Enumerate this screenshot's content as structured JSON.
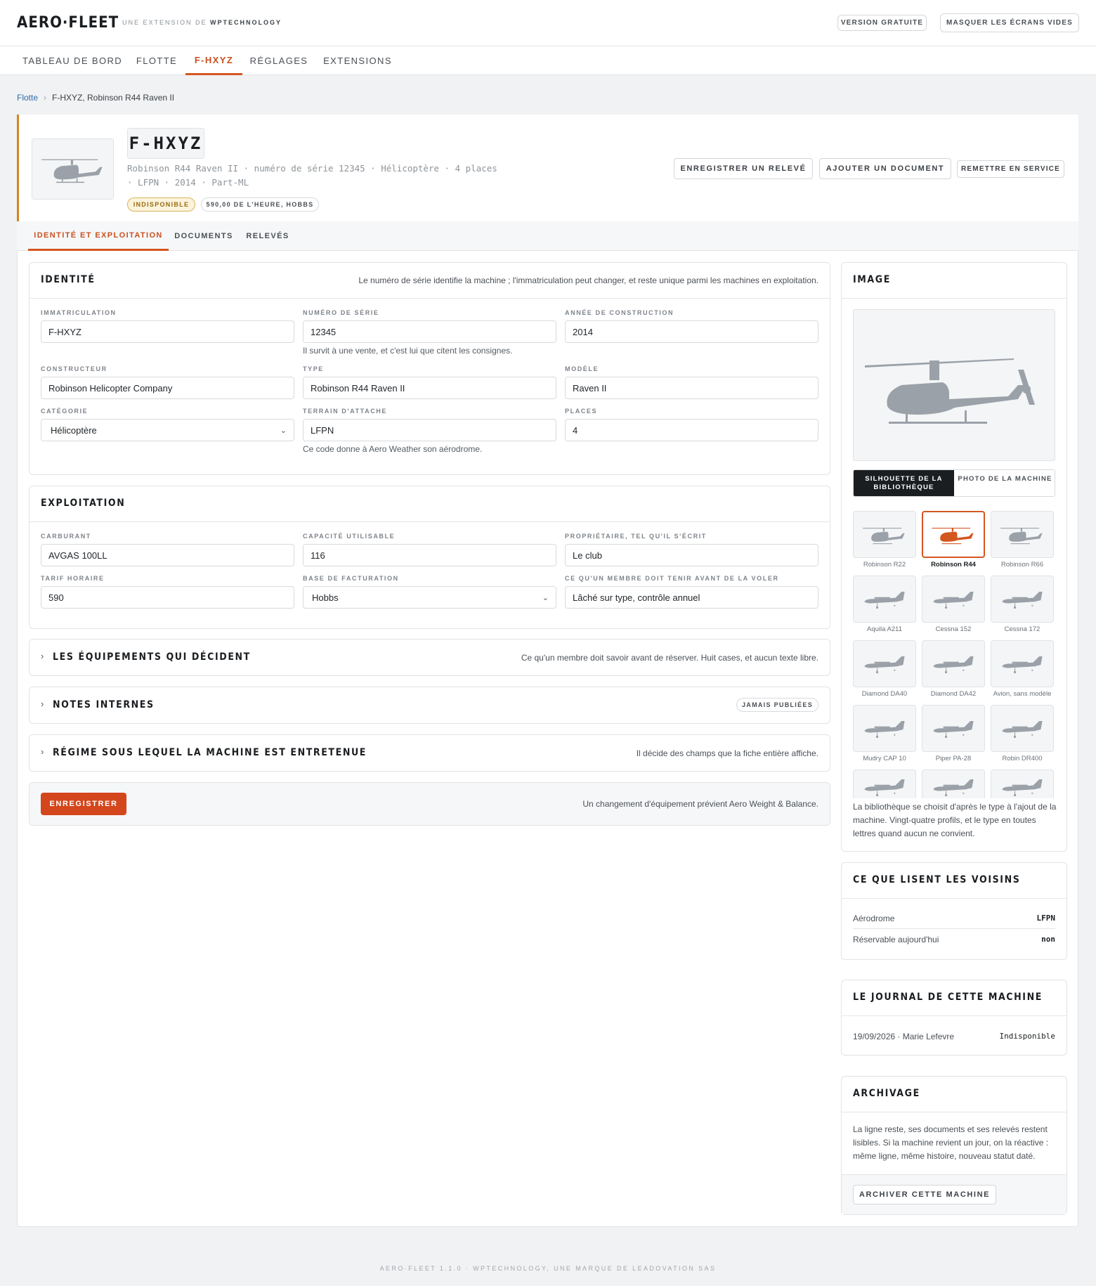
{
  "brand": {
    "logo": "AERO·FLEET",
    "tagline_prefix": "UNE EXTENSION DE",
    "tagline_brand": "WPTECHNOLOGY"
  },
  "top_actions": {
    "free_version": "VERSION GRATUITE",
    "hide_empty": "MASQUER LES ÉCRANS VIDES"
  },
  "nav": [
    "TABLEAU DE BORD",
    "FLOTTE",
    "F-HXYZ",
    "RÉGLAGES",
    "EXTENSIONS"
  ],
  "breadcrumb": {
    "root": "Flotte",
    "sep": "›",
    "current": "F-HXYZ, Robinson R44 Raven II"
  },
  "header": {
    "registration": "F-HXYZ",
    "meta_line1": "Robinson R44 Raven II · numéro de série 12345 · Hélicoptère · 4 places",
    "meta_line2": "· LFPN · 2014 · Part-ML",
    "status_badge": "INDISPONIBLE",
    "rate_badge": "590,00 DE L'HEURE, HOBBS",
    "actions": [
      "ENREGISTRER UN RELEVÉ",
      "AJOUTER UN DOCUMENT",
      "REMETTRE EN SERVICE"
    ]
  },
  "subtabs": [
    "IDENTITÉ ET EXPLOITATION",
    "DOCUMENTS",
    "RELEVÉS"
  ],
  "identity": {
    "title": "IDENTITÉ",
    "note": "Le numéro de série identifie la machine ; l'immatriculation peut changer, et reste unique parmi les machines en exploitation.",
    "fields": {
      "registration": {
        "label": "IMMATRICULATION",
        "value": "F-HXYZ"
      },
      "serial": {
        "label": "NUMÉRO DE SÉRIE",
        "value": "12345",
        "help": "Il survit à une vente, et c'est lui que citent les consignes."
      },
      "year": {
        "label": "ANNÉE DE CONSTRUCTION",
        "value": "2014"
      },
      "manufacturer": {
        "label": "CONSTRUCTEUR",
        "value": "Robinson Helicopter Company"
      },
      "type": {
        "label": "TYPE",
        "value": "Robinson R44 Raven II"
      },
      "model": {
        "label": "MODÈLE",
        "value": "Raven II"
      },
      "category": {
        "label": "CATÉGORIE",
        "value": "Hélicoptère"
      },
      "base": {
        "label": "TERRAIN D'ATTACHE",
        "value": "LFPN",
        "help": "Ce code donne à Aero Weather son aérodrome."
      },
      "seats": {
        "label": "PLACES",
        "value": "4"
      }
    }
  },
  "operation": {
    "title": "EXPLOITATION",
    "fields": {
      "fuel": {
        "label": "CARBURANT",
        "value": "AVGAS 100LL"
      },
      "capacity": {
        "label": "CAPACITÉ UTILISABLE",
        "value": "116"
      },
      "owner": {
        "label": "PROPRIÉTAIRE, TEL QU'IL S'ÉCRIT",
        "value": "Le club"
      },
      "rate": {
        "label": "TARIF HORAIRE",
        "value": "590"
      },
      "billing": {
        "label": "BASE DE FACTURATION",
        "value": "Hobbs"
      },
      "requirement": {
        "label": "CE QU'UN MEMBRE DOIT TENIR AVANT DE LA VOLER",
        "value": "Lâché sur type, contrôle annuel"
      }
    }
  },
  "collapsibles": [
    {
      "title": "LES ÉQUIPEMENTS QUI DÉCIDENT",
      "note": "Ce qu'un membre doit savoir avant de réserver. Huit cases, et aucun texte libre."
    },
    {
      "title": "NOTES INTERNES",
      "badge": "JAMAIS PUBLIÉES"
    },
    {
      "title": "RÉGIME SOUS LEQUEL LA MACHINE EST ENTRETENUE",
      "note": "Il décide des champs que la fiche entière affiche."
    }
  ],
  "save": {
    "label": "ENREGISTRER",
    "note": "Un changement d'équipement prévient Aero Weight & Balance."
  },
  "image_panel": {
    "title": "IMAGE",
    "toggle": [
      "SILHOUETTE DE LA BIBLIOTHÈQUE",
      "PHOTO DE LA MACHINE"
    ],
    "silhouettes": [
      "Robinson R22",
      "Robinson R44",
      "Robinson R66",
      "Aquila A211",
      "Cessna 152",
      "Cessna 172",
      "Diamond DA40",
      "Diamond DA42",
      "Avion, sans modèle",
      "Mudry CAP 10",
      "Piper PA-28",
      "Robin DR400"
    ],
    "selected": "Robinson R44",
    "help": "La bibliothèque se choisit d'après le type à l'ajout de la machine. Vingt-quatre profils, et le type en toutes lettres quand aucun ne convient.",
    "accent_color": "#d4561f"
  },
  "neighbors": {
    "title": "CE QUE LISENT LES VOISINS",
    "rows": [
      {
        "k": "Aérodrome",
        "v": "LFPN"
      },
      {
        "k": "Réservable aujourd'hui",
        "v": "non"
      }
    ]
  },
  "journal": {
    "title": "LE JOURNAL DE CETTE MACHINE",
    "entry": "19/09/2026 · Marie Lefevre",
    "status": "Indisponible"
  },
  "archive": {
    "title": "ARCHIVAGE",
    "text": "La ligne reste, ses documents et ses relevés restent lisibles. Si la machine revient un jour, on la réactive : même ligne, même histoire, nouveau statut daté.",
    "button": "ARCHIVER CETTE MACHINE"
  },
  "footer": "AERO·FLEET 1.1.0 · WPTECHNOLOGY, UNE MARQUE DE LEADOVATION SAS"
}
